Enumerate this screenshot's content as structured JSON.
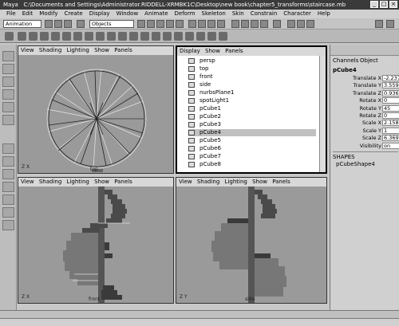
{
  "window": {
    "app": "Maya",
    "path": "C:\\Documents and Settings\\Administrator.RIDDELL-XRMBK1C\\Desktop\\new book\\chapter5_transforms\\staircase.mb",
    "buttons": [
      "_",
      "□",
      "×"
    ]
  },
  "menubar": [
    "File",
    "Edit",
    "Modify",
    "Create",
    "Display",
    "Window",
    "Animate",
    "Deform",
    "Skeleton",
    "Skin",
    "Constrain",
    "Character",
    "Help"
  ],
  "toolbar": {
    "mode_select": "Animation",
    "objects_field": "Objects"
  },
  "viewports": {
    "top_left": {
      "menu": [
        "View",
        "Shading",
        "Lighting",
        "Show",
        "Panels"
      ],
      "label": "top",
      "axis": "Z X"
    },
    "bottom_left": {
      "menu": [
        "View",
        "Shading",
        "Lighting",
        "Show",
        "Panels"
      ],
      "label": "front",
      "axis": "Z X"
    },
    "bottom_right": {
      "menu": [
        "View",
        "Shading",
        "Lighting",
        "Show",
        "Panels"
      ],
      "label": "side",
      "axis": "Z Y"
    }
  },
  "outliner": {
    "menu": [
      "Display",
      "Show",
      "Panels"
    ],
    "items": [
      {
        "label": "persp",
        "selected": false
      },
      {
        "label": "top",
        "selected": false
      },
      {
        "label": "front",
        "selected": false
      },
      {
        "label": "side",
        "selected": false
      },
      {
        "label": "nurbsPlane1",
        "selected": false
      },
      {
        "label": "spotLight1",
        "selected": false
      },
      {
        "label": "pCube1",
        "selected": false
      },
      {
        "label": "pCube2",
        "selected": false
      },
      {
        "label": "pCube3",
        "selected": false
      },
      {
        "label": "pCube4",
        "selected": true
      },
      {
        "label": "pCube5",
        "selected": false
      },
      {
        "label": "pCube6",
        "selected": false
      },
      {
        "label": "pCube7",
        "selected": false
      },
      {
        "label": "pCube8",
        "selected": false
      }
    ]
  },
  "channel_box": {
    "header": [
      "Channels",
      "Object"
    ],
    "object": "pCube4",
    "attributes": [
      {
        "name": "Translate X",
        "value": "-2.237"
      },
      {
        "name": "Translate Y",
        "value": "3.559"
      },
      {
        "name": "Translate Z",
        "value": "0.936"
      },
      {
        "name": "Rotate X",
        "value": "0"
      },
      {
        "name": "Rotate Y",
        "value": "45"
      },
      {
        "name": "Rotate Z",
        "value": "0"
      },
      {
        "name": "Scale X",
        "value": "2.158"
      },
      {
        "name": "Scale Y",
        "value": "1"
      },
      {
        "name": "Scale Z",
        "value": "6.369"
      },
      {
        "name": "Visibility",
        "value": "on"
      }
    ],
    "shapes_header": "SHAPES",
    "shape": "pCubeShape4"
  }
}
